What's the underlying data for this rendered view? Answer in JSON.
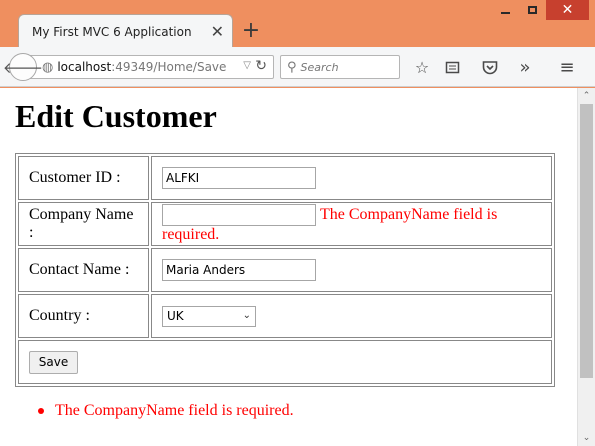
{
  "browser": {
    "tab_title": "My First MVC 6 Application",
    "url_host": "localhost",
    "url_rest": ":49349/Home/Save",
    "search_placeholder": "Search"
  },
  "page": {
    "heading": "Edit Customer",
    "fields": {
      "customer_id": {
        "label": "Customer ID :",
        "value": "ALFKI"
      },
      "company_name": {
        "label": "Company Name :",
        "value": "",
        "error": "The CompanyName field is required."
      },
      "contact_name": {
        "label": "Contact Name :",
        "value": "Maria Anders"
      },
      "country": {
        "label": "Country :",
        "selected": "UK"
      }
    },
    "save_label": "Save",
    "validation_summary": [
      "The CompanyName field is required."
    ]
  },
  "colors": {
    "error": "#ff0000",
    "frame": "#ef8f5f",
    "close": "#c7402e"
  }
}
